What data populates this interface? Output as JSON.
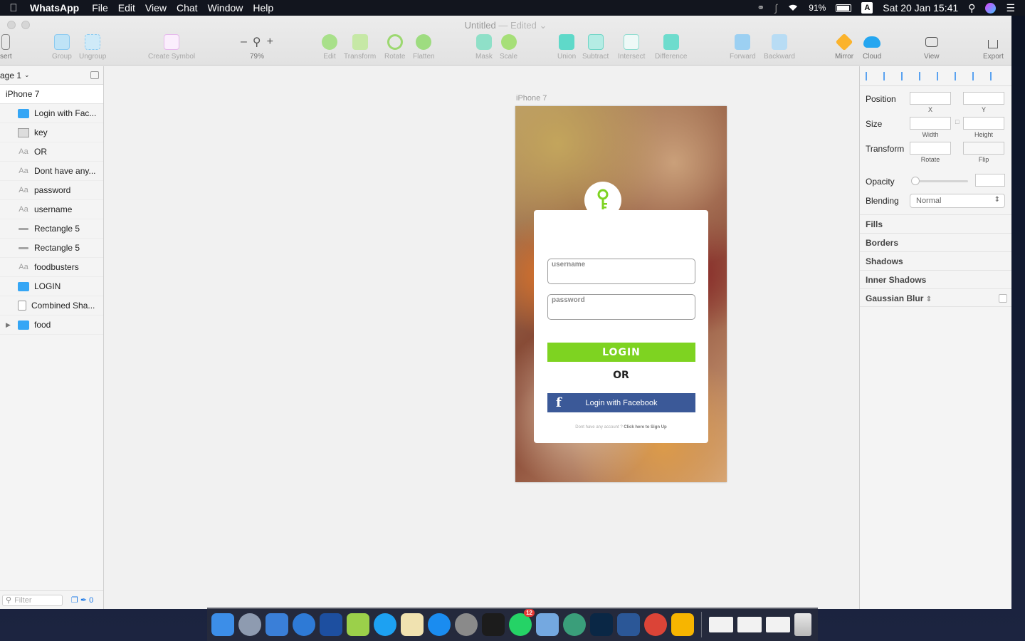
{
  "menubar": {
    "app_name": "WhatsApp",
    "menus": [
      "File",
      "Edit",
      "View",
      "Chat",
      "Window",
      "Help"
    ],
    "battery": "91%",
    "input_badge": "A",
    "datetime": "Sat 20 Jan  15:41"
  },
  "window": {
    "doc_title": "Untitled",
    "doc_state": "— Edited",
    "toolbar": [
      {
        "label": "sert",
        "x": 0
      },
      {
        "label": "Group"
      },
      {
        "label": "Ungroup"
      },
      {
        "label": "Create Symbol"
      },
      {
        "label": "79%"
      },
      {
        "label": "Edit"
      },
      {
        "label": "Transform"
      },
      {
        "label": "Rotate"
      },
      {
        "label": "Flatten"
      },
      {
        "label": "Mask"
      },
      {
        "label": "Scale"
      },
      {
        "label": "Union"
      },
      {
        "label": "Subtract"
      },
      {
        "label": "Intersect"
      },
      {
        "label": "Difference"
      },
      {
        "label": "Forward"
      },
      {
        "label": "Backward"
      },
      {
        "label": "Mirror"
      },
      {
        "label": "Cloud"
      },
      {
        "label": "View"
      },
      {
        "label": "Export"
      }
    ]
  },
  "layers": {
    "page": "age 1",
    "artboard": "iPhone 7",
    "items": [
      {
        "name": "Login with Fac...",
        "kind": "folder"
      },
      {
        "name": "key",
        "kind": "image"
      },
      {
        "name": "OR",
        "kind": "text"
      },
      {
        "name": "Dont have any...",
        "kind": "text"
      },
      {
        "name": "password",
        "kind": "text"
      },
      {
        "name": "username",
        "kind": "text"
      },
      {
        "name": "Rectangle 5",
        "kind": "rect"
      },
      {
        "name": "Rectangle 5",
        "kind": "rect"
      },
      {
        "name": "foodbusters",
        "kind": "text"
      },
      {
        "name": "LOGIN",
        "kind": "folder"
      },
      {
        "name": "Combined Sha...",
        "kind": "shape"
      },
      {
        "name": "food",
        "kind": "folder"
      }
    ],
    "text_glyph": "Aa",
    "filter_placeholder": "Filter",
    "filter_count": "0"
  },
  "canvas": {
    "artboard_label": "iPhone 7",
    "screen": {
      "username_placeholder": "username",
      "password_placeholder": "password",
      "login_label": "LOGIN",
      "or_label": "OR",
      "facebook_label": "Login with Facebook",
      "signup_prefix": "Dont have any account ?",
      "signup_link": "Click here to Sign Up"
    }
  },
  "inspector": {
    "position": "Position",
    "x": "X",
    "y": "Y",
    "size": "Size",
    "width": "Width",
    "height": "Height",
    "transform": "Transform",
    "rotate": "Rotate",
    "flip": "Flip",
    "opacity": "Opacity",
    "blending": "Blending",
    "blending_value": "Normal",
    "sections": [
      "Fills",
      "Borders",
      "Shadows",
      "Inner Shadows",
      "Gaussian Blur"
    ]
  },
  "dock": {
    "whatsapp_badge": "12",
    "apps": [
      "finder-icon",
      "launchpad-icon",
      "xcode-icon",
      "safari-icon",
      "sourcetree-icon",
      "android-studio-icon",
      "twitter-icon",
      "preview-icon",
      "app-store-icon",
      "system-preferences-icon",
      "terminal-icon",
      "whatsapp-icon",
      "maps-icon",
      "atom-icon",
      "photoshop-icon",
      "word-icon",
      "chrome-icon",
      "sketch-icon"
    ],
    "colors": [
      "#3c8ee8",
      "#8e9bb0",
      "#3a7fd8",
      "#2e7ad6",
      "#1d4fa0",
      "#9bd04a",
      "#1da1f2",
      "#f0e2b0",
      "#1a8cf0",
      "#8a8a8a",
      "#1c1c1c",
      "#25d366",
      "#74a8e0",
      "#3a9e7a",
      "#0a2745",
      "#2b5797",
      "#db4437",
      "#f7b500"
    ]
  }
}
